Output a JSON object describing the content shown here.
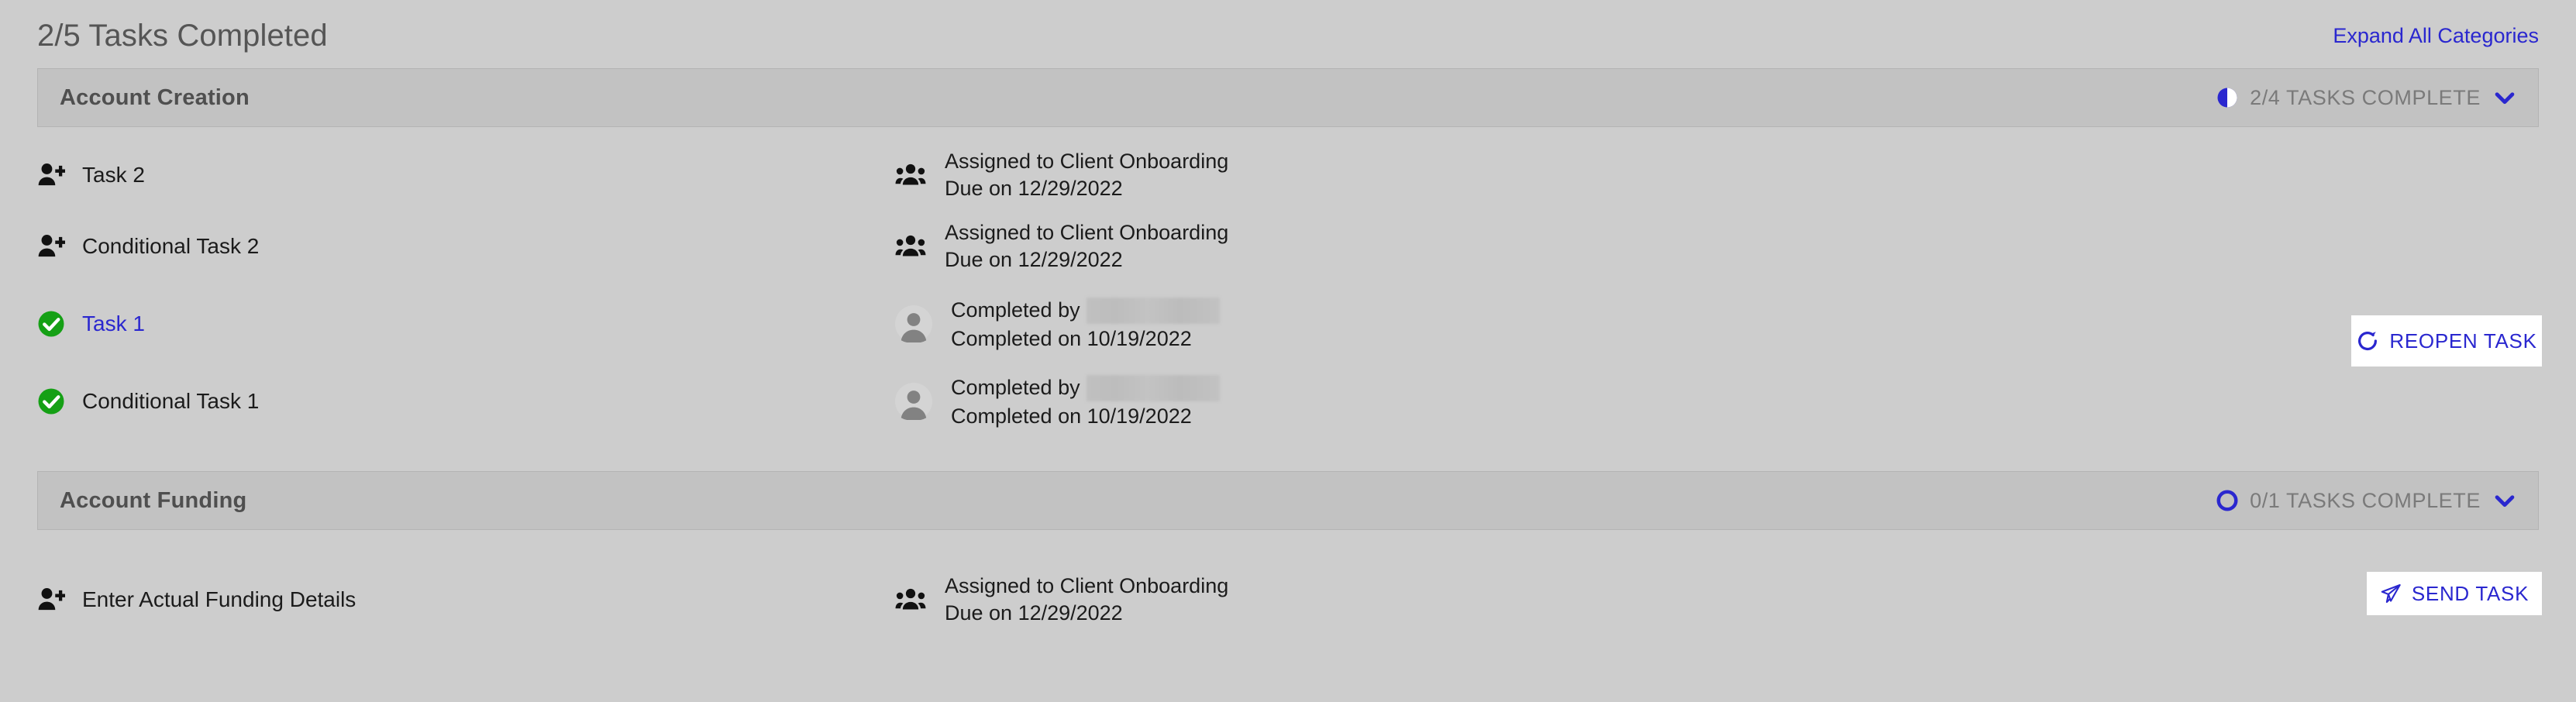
{
  "header": {
    "title": "2/5 Tasks Completed",
    "expand_all_label": "Expand All Categories"
  },
  "colors": {
    "page_background": "#cdcdcd",
    "category_bar": "#c2c2c2",
    "link_blue": "#2a27cf",
    "complete_green": "#15a015",
    "title_gray": "#555555",
    "status_gray": "#7a7a7a",
    "button_background": "#ffffff"
  },
  "categories": [
    {
      "name": "Account Creation",
      "status_text": "2/4 TASKS COMPLETE",
      "status_icon": "half-filled-circle-icon",
      "expand_icon": "chevron-down-icon",
      "tasks": [
        {
          "label": "Task 2",
          "status": "pending",
          "status_icon": "user-plus-icon",
          "is_link": false,
          "meta_icon": "users-group-icon",
          "meta_line_1": "Assigned to Client Onboarding",
          "meta_line_2": "Due on 12/29/2022",
          "redacted": false,
          "action": null
        },
        {
          "label": "Conditional Task 2",
          "status": "pending",
          "status_icon": "user-plus-icon",
          "is_link": false,
          "meta_icon": "users-group-icon",
          "meta_line_1": "Assigned to Client Onboarding",
          "meta_line_2": "Due on 12/29/2022",
          "redacted": false,
          "action": null
        },
        {
          "label": "Task 1",
          "status": "complete",
          "status_icon": "check-circle-icon",
          "is_link": true,
          "meta_icon": "avatar-icon",
          "meta_line_1": "Completed by",
          "meta_line_2": "Completed on 10/19/2022",
          "redacted": true,
          "action": {
            "label": "REOPEN TASK",
            "icon": "refresh-icon"
          }
        },
        {
          "label": "Conditional Task 1",
          "status": "complete",
          "status_icon": "check-circle-icon",
          "is_link": false,
          "meta_icon": "avatar-icon",
          "meta_line_1": "Completed by",
          "meta_line_2": "Completed on 10/19/2022",
          "redacted": true,
          "action": null
        }
      ]
    },
    {
      "name": "Account Funding",
      "status_text": "0/1 TASKS COMPLETE",
      "status_icon": "empty-circle-icon",
      "expand_icon": "chevron-down-icon",
      "tasks": [
        {
          "label": "Enter Actual Funding Details",
          "status": "pending",
          "status_icon": "user-plus-icon",
          "is_link": false,
          "meta_icon": "users-group-icon",
          "meta_line_1": "Assigned to Client Onboarding",
          "meta_line_2": "Due on 12/29/2022",
          "redacted": false,
          "action": {
            "label": "SEND TASK",
            "icon": "paper-plane-icon"
          }
        }
      ]
    }
  ]
}
